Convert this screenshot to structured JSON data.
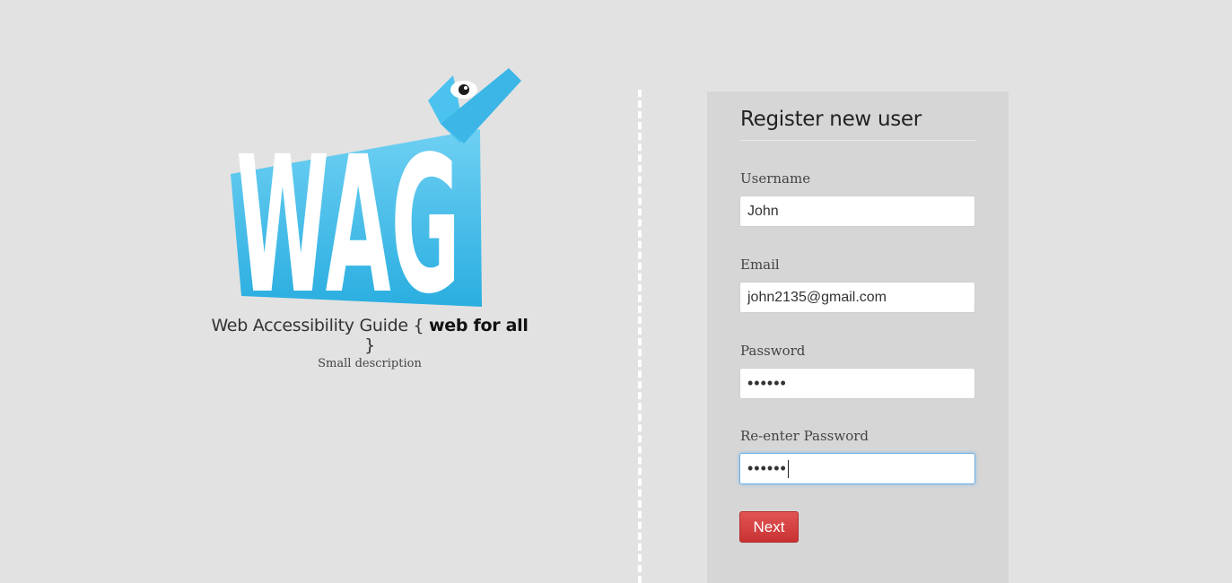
{
  "brand": {
    "logo_text": "WAG",
    "tagline_prefix": "Web Accessibility Guide {",
    "tagline_strong": "web for all",
    "tagline_suffix": "}",
    "description": "Small description",
    "logo_color": "#3bbbe8"
  },
  "form": {
    "title": "Register new user",
    "fields": [
      {
        "label": "Username",
        "value": "John",
        "type": "text"
      },
      {
        "label": "Email",
        "value": "john2135@gmail.com",
        "type": "email"
      },
      {
        "label": "Password",
        "value": "••••••",
        "type": "password"
      },
      {
        "label": "Re-enter Password",
        "value": "••••••",
        "type": "password",
        "focused": true
      }
    ],
    "submit_label": "Next"
  },
  "colors": {
    "background": "#e2e2e2",
    "panel": "#d6d6d6",
    "button": "#d23c3c",
    "focus": "#6fb1e6"
  }
}
